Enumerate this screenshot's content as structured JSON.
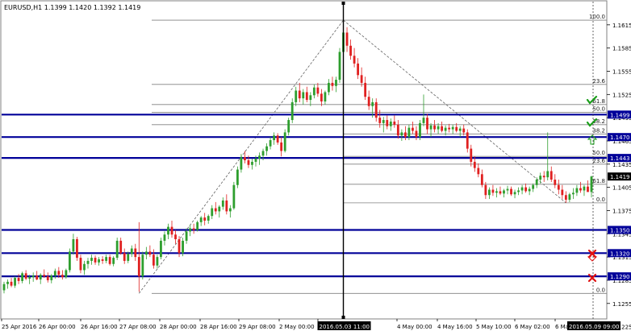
{
  "chart_data": {
    "type": "candlestick",
    "symbol_header": "EURUSD,H1  1.1399 1.1420 1.1392 1.1419",
    "colors": {
      "background": "#ffffff",
      "bull": "#2e9e2e",
      "bear": "#e02020",
      "level_line": "#000099",
      "price_label_bg": "#000099",
      "fib_line": "#808080",
      "crosshair": "#000000",
      "check": "#1a9e1a",
      "cross": "#e01010"
    },
    "y_axis": {
      "ylim": [
        1.1235,
        1.1645
      ],
      "ticks": [
        "1.1615",
        "1.1585",
        "1.1555",
        "1.1525",
        "1.1495",
        "1.1465",
        "1.1435",
        "1.1405",
        "1.1375",
        "1.1345",
        "1.1315",
        "1.1285",
        "1.1255",
        "1.1225"
      ]
    },
    "x_axis": {
      "labels": [
        "25 Apr 2016",
        "26 Apr 00:00",
        "26 Apr 16:00",
        "27 Apr 08:00",
        "28 Apr 00:00",
        "28 Apr 16:00",
        "29 Apr 08:00",
        "2 May 00:00",
        "2 May 16:00",
        "4 May 00:00",
        "4 May 16:00",
        "5 May 10:00",
        "6 May 02:00",
        "6 May 18:00"
      ],
      "highlight_labels": [
        "2016.05.03 11:00",
        "2016.05.09 09:00"
      ]
    },
    "levels": [
      {
        "price": 1.1499,
        "label": "1.1499"
      },
      {
        "price": 1.147,
        "label": "1.1470"
      },
      {
        "price": 1.1443,
        "label": "1.1443"
      },
      {
        "price": 1.135,
        "label": "1.1350"
      },
      {
        "price": 1.132,
        "label": "1.1320"
      },
      {
        "price": 1.129,
        "label": "1.1290"
      }
    ],
    "current_price": {
      "price": 1.1419,
      "label": "1.1419"
    },
    "fib_up": {
      "low": 1.1268,
      "high": 1.1621,
      "levels": [
        {
          "price": 1.1621,
          "label": "100.0"
        },
        {
          "price": 1.1538,
          "label": "23.6"
        },
        {
          "price": 1.1512,
          "label": "61.8"
        },
        {
          "price": 1.1502,
          "label": "50.0"
        },
        {
          "price": 1.1486,
          "label": "38.2"
        },
        {
          "price": 1.1268,
          "label": "0.0"
        }
      ]
    },
    "fib_down": {
      "high": 1.1621,
      "low": 1.1385,
      "levels": [
        {
          "price": 1.1474,
          "label": "38.2"
        },
        {
          "price": 1.1445,
          "label": "50.0"
        },
        {
          "price": 1.1435,
          "label": "23.6"
        },
        {
          "price": 1.1409,
          "label": "61.8"
        },
        {
          "price": 1.1385,
          "label": "0.0"
        }
      ]
    },
    "candles": [
      [
        1.1272,
        1.1283,
        1.1268,
        1.128
      ],
      [
        1.128,
        1.1286,
        1.1274,
        1.1283
      ],
      [
        1.1283,
        1.1288,
        1.1276,
        1.1278
      ],
      [
        1.1278,
        1.129,
        1.1275,
        1.1288
      ],
      [
        1.1288,
        1.1293,
        1.128,
        1.1284
      ],
      [
        1.1284,
        1.1296,
        1.1281,
        1.1294
      ],
      [
        1.1294,
        1.1298,
        1.1285,
        1.1287
      ],
      [
        1.1287,
        1.1292,
        1.128,
        1.1289
      ],
      [
        1.1289,
        1.1295,
        1.1283,
        1.1291
      ],
      [
        1.1291,
        1.1297,
        1.1285,
        1.1286
      ],
      [
        1.1286,
        1.1294,
        1.128,
        1.1292
      ],
      [
        1.1292,
        1.1299,
        1.1288,
        1.129
      ],
      [
        1.129,
        1.1295,
        1.1282,
        1.1285
      ],
      [
        1.1285,
        1.1293,
        1.1281,
        1.1291
      ],
      [
        1.1291,
        1.13,
        1.1287,
        1.1297
      ],
      [
        1.1297,
        1.1302,
        1.1288,
        1.1292
      ],
      [
        1.1292,
        1.1298,
        1.1286,
        1.1289
      ],
      [
        1.1289,
        1.13,
        1.1287,
        1.1298
      ],
      [
        1.1298,
        1.1326,
        1.1295,
        1.1322
      ],
      [
        1.1322,
        1.1345,
        1.1318,
        1.1338
      ],
      [
        1.1338,
        1.1341,
        1.131,
        1.1314
      ],
      [
        1.1314,
        1.1318,
        1.1294,
        1.1298
      ],
      [
        1.1298,
        1.131,
        1.1292,
        1.1306
      ],
      [
        1.1306,
        1.1314,
        1.13,
        1.131
      ],
      [
        1.131,
        1.1318,
        1.1305,
        1.1314
      ],
      [
        1.1314,
        1.1317,
        1.1305,
        1.1308
      ],
      [
        1.1308,
        1.1315,
        1.1304,
        1.1312
      ],
      [
        1.1312,
        1.1316,
        1.1306,
        1.131
      ],
      [
        1.131,
        1.1318,
        1.1307,
        1.1315
      ],
      [
        1.1315,
        1.1318,
        1.1304,
        1.1306
      ],
      [
        1.1306,
        1.1316,
        1.1303,
        1.1314
      ],
      [
        1.1314,
        1.134,
        1.1311,
        1.1336
      ],
      [
        1.1336,
        1.134,
        1.1318,
        1.132
      ],
      [
        1.132,
        1.1326,
        1.1306,
        1.131
      ],
      [
        1.131,
        1.1322,
        1.1307,
        1.1319
      ],
      [
        1.1319,
        1.133,
        1.1315,
        1.1326
      ],
      [
        1.1326,
        1.1332,
        1.131,
        1.1315
      ],
      [
        1.1315,
        1.136,
        1.127,
        1.129
      ],
      [
        1.129,
        1.1322,
        1.1286,
        1.1318
      ],
      [
        1.1318,
        1.1328,
        1.1312,
        1.1322
      ],
      [
        1.1322,
        1.133,
        1.1315,
        1.1318
      ],
      [
        1.1318,
        1.1325,
        1.13,
        1.1304
      ],
      [
        1.1304,
        1.1318,
        1.13,
        1.1315
      ],
      [
        1.1315,
        1.134,
        1.1312,
        1.1336
      ],
      [
        1.1336,
        1.1348,
        1.133,
        1.1344
      ],
      [
        1.1344,
        1.1358,
        1.1338,
        1.1354
      ],
      [
        1.1354,
        1.1362,
        1.134,
        1.1344
      ],
      [
        1.1344,
        1.135,
        1.1332,
        1.1338
      ],
      [
        1.1338,
        1.1342,
        1.1315,
        1.132
      ],
      [
        1.132,
        1.134,
        1.1316,
        1.1336
      ],
      [
        1.1336,
        1.1352,
        1.1332,
        1.1348
      ],
      [
        1.1348,
        1.1356,
        1.1342,
        1.1352
      ],
      [
        1.1352,
        1.1358,
        1.1345,
        1.135
      ],
      [
        1.135,
        1.1362,
        1.1348,
        1.136
      ],
      [
        1.136,
        1.1368,
        1.1355,
        1.1366
      ],
      [
        1.1366,
        1.1372,
        1.1356,
        1.1362
      ],
      [
        1.1362,
        1.137,
        1.1358,
        1.1368
      ],
      [
        1.1368,
        1.1382,
        1.1364,
        1.1378
      ],
      [
        1.1378,
        1.1386,
        1.137,
        1.1374
      ],
      [
        1.1374,
        1.1382,
        1.1366,
        1.138
      ],
      [
        1.138,
        1.1392,
        1.1376,
        1.1388
      ],
      [
        1.1388,
        1.1396,
        1.137,
        1.1374
      ],
      [
        1.1374,
        1.1382,
        1.1366,
        1.1378
      ],
      [
        1.1378,
        1.1412,
        1.1376,
        1.1408
      ],
      [
        1.1408,
        1.1432,
        1.1404,
        1.1428
      ],
      [
        1.1428,
        1.1448,
        1.1424,
        1.1444
      ],
      [
        1.1444,
        1.1452,
        1.1436,
        1.144
      ],
      [
        1.144,
        1.1446,
        1.143,
        1.1434
      ],
      [
        1.1434,
        1.1442,
        1.1428,
        1.1438
      ],
      [
        1.1438,
        1.1446,
        1.1432,
        1.1442
      ],
      [
        1.1442,
        1.145,
        1.1434,
        1.1446
      ],
      [
        1.1446,
        1.1455,
        1.144,
        1.1452
      ],
      [
        1.1452,
        1.1462,
        1.1446,
        1.1458
      ],
      [
        1.1458,
        1.147,
        1.1454,
        1.1466
      ],
      [
        1.1466,
        1.1476,
        1.146,
        1.1472
      ],
      [
        1.1472,
        1.1475,
        1.146,
        1.1463
      ],
      [
        1.1463,
        1.147,
        1.1445,
        1.1452
      ],
      [
        1.1452,
        1.148,
        1.145,
        1.1476
      ],
      [
        1.1476,
        1.1495,
        1.1472,
        1.1492
      ],
      [
        1.1492,
        1.152,
        1.1488,
        1.1515
      ],
      [
        1.1515,
        1.1535,
        1.151,
        1.153
      ],
      [
        1.153,
        1.154,
        1.1515,
        1.152
      ],
      [
        1.152,
        1.1532,
        1.1512,
        1.1528
      ],
      [
        1.1528,
        1.1535,
        1.1515,
        1.1518
      ],
      [
        1.1518,
        1.1528,
        1.151,
        1.1524
      ],
      [
        1.1524,
        1.1538,
        1.152,
        1.1534
      ],
      [
        1.1534,
        1.154,
        1.1522,
        1.1526
      ],
      [
        1.1526,
        1.1532,
        1.151,
        1.1516
      ],
      [
        1.1516,
        1.153,
        1.1512,
        1.1528
      ],
      [
        1.1528,
        1.1545,
        1.1524,
        1.154
      ],
      [
        1.154,
        1.1548,
        1.153,
        1.1536
      ],
      [
        1.1536,
        1.1548,
        1.1528,
        1.1544
      ],
      [
        1.1544,
        1.1585,
        1.154,
        1.158
      ],
      [
        1.158,
        1.1621,
        1.1575,
        1.1605
      ],
      [
        1.1605,
        1.1612,
        1.158,
        1.1588
      ],
      [
        1.1588,
        1.1596,
        1.157,
        1.1575
      ],
      [
        1.1575,
        1.1585,
        1.156,
        1.1565
      ],
      [
        1.1565,
        1.1572,
        1.1545,
        1.155
      ],
      [
        1.155,
        1.156,
        1.1535,
        1.154
      ],
      [
        1.154,
        1.1548,
        1.1518,
        1.1522
      ],
      [
        1.1522,
        1.153,
        1.1505,
        1.151
      ],
      [
        1.151,
        1.152,
        1.1495,
        1.1515
      ],
      [
        1.1515,
        1.152,
        1.149,
        1.1495
      ],
      [
        1.1495,
        1.1505,
        1.1482,
        1.1488
      ],
      [
        1.1488,
        1.1496,
        1.1476,
        1.1492
      ],
      [
        1.1492,
        1.1498,
        1.148,
        1.1484
      ],
      [
        1.1484,
        1.1494,
        1.1478,
        1.149
      ],
      [
        1.149,
        1.1498,
        1.1482,
        1.1486
      ],
      [
        1.1486,
        1.1492,
        1.1468,
        1.1472
      ],
      [
        1.1472,
        1.148,
        1.1465,
        1.1476
      ],
      [
        1.1476,
        1.1484,
        1.1466,
        1.147
      ],
      [
        1.147,
        1.1486,
        1.1466,
        1.1482
      ],
      [
        1.1482,
        1.149,
        1.1474,
        1.1478
      ],
      [
        1.1478,
        1.1484,
        1.1466,
        1.147
      ],
      [
        1.147,
        1.1492,
        1.1466,
        1.1488
      ],
      [
        1.1488,
        1.1525,
        1.1484,
        1.1495
      ],
      [
        1.1495,
        1.15,
        1.1474,
        1.148
      ],
      [
        1.148,
        1.1488,
        1.147,
        1.1485
      ],
      [
        1.1485,
        1.1492,
        1.1476,
        1.148
      ],
      [
        1.148,
        1.1488,
        1.1474,
        1.1484
      ],
      [
        1.1484,
        1.149,
        1.1476,
        1.1478
      ],
      [
        1.1478,
        1.1485,
        1.1472,
        1.1482
      ],
      [
        1.1482,
        1.1487,
        1.1476,
        1.148
      ],
      [
        1.148,
        1.1486,
        1.1474,
        1.1483
      ],
      [
        1.1483,
        1.1488,
        1.1476,
        1.1478
      ],
      [
        1.1478,
        1.1484,
        1.147,
        1.1481
      ],
      [
        1.1481,
        1.1486,
        1.1472,
        1.1476
      ],
      [
        1.1476,
        1.148,
        1.145,
        1.1455
      ],
      [
        1.1455,
        1.146,
        1.1432,
        1.1438
      ],
      [
        1.1438,
        1.1445,
        1.1425,
        1.143
      ],
      [
        1.143,
        1.1436,
        1.1418,
        1.1422
      ],
      [
        1.1422,
        1.1428,
        1.1405,
        1.1408
      ],
      [
        1.1408,
        1.1412,
        1.139,
        1.1395
      ],
      [
        1.1395,
        1.1405,
        1.139,
        1.1402
      ],
      [
        1.1402,
        1.1408,
        1.1394,
        1.1398
      ],
      [
        1.1398,
        1.1404,
        1.1392,
        1.14
      ],
      [
        1.14,
        1.1406,
        1.1395,
        1.1397
      ],
      [
        1.1397,
        1.1403,
        1.1392,
        1.1401
      ],
      [
        1.1401,
        1.1407,
        1.1396,
        1.1403
      ],
      [
        1.1403,
        1.1406,
        1.1394,
        1.1396
      ],
      [
        1.1396,
        1.1402,
        1.1391,
        1.1399
      ],
      [
        1.1399,
        1.1405,
        1.1395,
        1.1401
      ],
      [
        1.1401,
        1.1408,
        1.1396,
        1.1405
      ],
      [
        1.1405,
        1.141,
        1.1398,
        1.14
      ],
      [
        1.14,
        1.1406,
        1.1395,
        1.1403
      ],
      [
        1.1403,
        1.141,
        1.1399,
        1.1408
      ],
      [
        1.1408,
        1.1418,
        1.1404,
        1.1415
      ],
      [
        1.1415,
        1.1424,
        1.141,
        1.142
      ],
      [
        1.142,
        1.1426,
        1.1412,
        1.1418
      ],
      [
        1.1418,
        1.1476,
        1.1414,
        1.1426
      ],
      [
        1.1426,
        1.1432,
        1.1412,
        1.1415
      ],
      [
        1.1415,
        1.1422,
        1.1404,
        1.1408
      ],
      [
        1.1408,
        1.1415,
        1.1396,
        1.1402
      ],
      [
        1.1402,
        1.1408,
        1.139,
        1.1395
      ],
      [
        1.1395,
        1.14,
        1.1385,
        1.1389
      ],
      [
        1.1389,
        1.1398,
        1.1386,
        1.1396
      ],
      [
        1.1396,
        1.1404,
        1.139,
        1.1398
      ],
      [
        1.1398,
        1.1408,
        1.1394,
        1.1404
      ],
      [
        1.1404,
        1.1412,
        1.1398,
        1.1401
      ],
      [
        1.1401,
        1.1408,
        1.1394,
        1.1406
      ],
      [
        1.1406,
        1.1414,
        1.14,
        1.1399
      ],
      [
        1.1399,
        1.142,
        1.1392,
        1.1419
      ]
    ]
  }
}
